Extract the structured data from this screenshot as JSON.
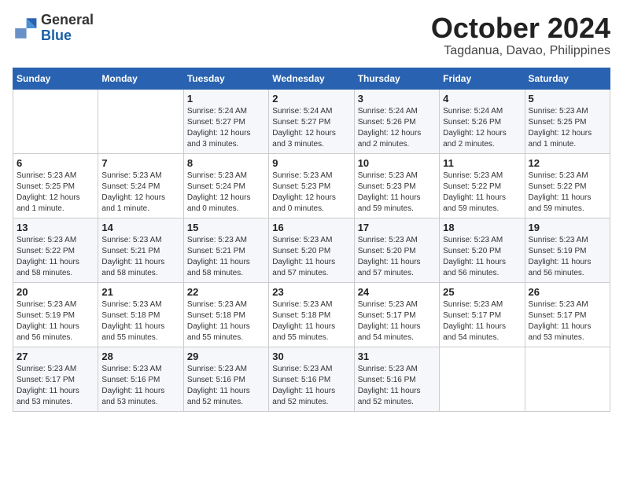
{
  "logo": {
    "general": "General",
    "blue": "Blue"
  },
  "title": "October 2024",
  "subtitle": "Tagdanua, Davao, Philippines",
  "headers": [
    "Sunday",
    "Monday",
    "Tuesday",
    "Wednesday",
    "Thursday",
    "Friday",
    "Saturday"
  ],
  "weeks": [
    [
      {
        "day": "",
        "detail": ""
      },
      {
        "day": "",
        "detail": ""
      },
      {
        "day": "1",
        "detail": "Sunrise: 5:24 AM\nSunset: 5:27 PM\nDaylight: 12 hours\nand 3 minutes."
      },
      {
        "day": "2",
        "detail": "Sunrise: 5:24 AM\nSunset: 5:27 PM\nDaylight: 12 hours\nand 3 minutes."
      },
      {
        "day": "3",
        "detail": "Sunrise: 5:24 AM\nSunset: 5:26 PM\nDaylight: 12 hours\nand 2 minutes."
      },
      {
        "day": "4",
        "detail": "Sunrise: 5:24 AM\nSunset: 5:26 PM\nDaylight: 12 hours\nand 2 minutes."
      },
      {
        "day": "5",
        "detail": "Sunrise: 5:23 AM\nSunset: 5:25 PM\nDaylight: 12 hours\nand 1 minute."
      }
    ],
    [
      {
        "day": "6",
        "detail": "Sunrise: 5:23 AM\nSunset: 5:25 PM\nDaylight: 12 hours\nand 1 minute."
      },
      {
        "day": "7",
        "detail": "Sunrise: 5:23 AM\nSunset: 5:24 PM\nDaylight: 12 hours\nand 1 minute."
      },
      {
        "day": "8",
        "detail": "Sunrise: 5:23 AM\nSunset: 5:24 PM\nDaylight: 12 hours\nand 0 minutes."
      },
      {
        "day": "9",
        "detail": "Sunrise: 5:23 AM\nSunset: 5:23 PM\nDaylight: 12 hours\nand 0 minutes."
      },
      {
        "day": "10",
        "detail": "Sunrise: 5:23 AM\nSunset: 5:23 PM\nDaylight: 11 hours\nand 59 minutes."
      },
      {
        "day": "11",
        "detail": "Sunrise: 5:23 AM\nSunset: 5:22 PM\nDaylight: 11 hours\nand 59 minutes."
      },
      {
        "day": "12",
        "detail": "Sunrise: 5:23 AM\nSunset: 5:22 PM\nDaylight: 11 hours\nand 59 minutes."
      }
    ],
    [
      {
        "day": "13",
        "detail": "Sunrise: 5:23 AM\nSunset: 5:22 PM\nDaylight: 11 hours\nand 58 minutes."
      },
      {
        "day": "14",
        "detail": "Sunrise: 5:23 AM\nSunset: 5:21 PM\nDaylight: 11 hours\nand 58 minutes."
      },
      {
        "day": "15",
        "detail": "Sunrise: 5:23 AM\nSunset: 5:21 PM\nDaylight: 11 hours\nand 58 minutes."
      },
      {
        "day": "16",
        "detail": "Sunrise: 5:23 AM\nSunset: 5:20 PM\nDaylight: 11 hours\nand 57 minutes."
      },
      {
        "day": "17",
        "detail": "Sunrise: 5:23 AM\nSunset: 5:20 PM\nDaylight: 11 hours\nand 57 minutes."
      },
      {
        "day": "18",
        "detail": "Sunrise: 5:23 AM\nSunset: 5:20 PM\nDaylight: 11 hours\nand 56 minutes."
      },
      {
        "day": "19",
        "detail": "Sunrise: 5:23 AM\nSunset: 5:19 PM\nDaylight: 11 hours\nand 56 minutes."
      }
    ],
    [
      {
        "day": "20",
        "detail": "Sunrise: 5:23 AM\nSunset: 5:19 PM\nDaylight: 11 hours\nand 56 minutes."
      },
      {
        "day": "21",
        "detail": "Sunrise: 5:23 AM\nSunset: 5:18 PM\nDaylight: 11 hours\nand 55 minutes."
      },
      {
        "day": "22",
        "detail": "Sunrise: 5:23 AM\nSunset: 5:18 PM\nDaylight: 11 hours\nand 55 minutes."
      },
      {
        "day": "23",
        "detail": "Sunrise: 5:23 AM\nSunset: 5:18 PM\nDaylight: 11 hours\nand 55 minutes."
      },
      {
        "day": "24",
        "detail": "Sunrise: 5:23 AM\nSunset: 5:17 PM\nDaylight: 11 hours\nand 54 minutes."
      },
      {
        "day": "25",
        "detail": "Sunrise: 5:23 AM\nSunset: 5:17 PM\nDaylight: 11 hours\nand 54 minutes."
      },
      {
        "day": "26",
        "detail": "Sunrise: 5:23 AM\nSunset: 5:17 PM\nDaylight: 11 hours\nand 53 minutes."
      }
    ],
    [
      {
        "day": "27",
        "detail": "Sunrise: 5:23 AM\nSunset: 5:17 PM\nDaylight: 11 hours\nand 53 minutes."
      },
      {
        "day": "28",
        "detail": "Sunrise: 5:23 AM\nSunset: 5:16 PM\nDaylight: 11 hours\nand 53 minutes."
      },
      {
        "day": "29",
        "detail": "Sunrise: 5:23 AM\nSunset: 5:16 PM\nDaylight: 11 hours\nand 52 minutes."
      },
      {
        "day": "30",
        "detail": "Sunrise: 5:23 AM\nSunset: 5:16 PM\nDaylight: 11 hours\nand 52 minutes."
      },
      {
        "day": "31",
        "detail": "Sunrise: 5:23 AM\nSunset: 5:16 PM\nDaylight: 11 hours\nand 52 minutes."
      },
      {
        "day": "",
        "detail": ""
      },
      {
        "day": "",
        "detail": ""
      }
    ]
  ]
}
